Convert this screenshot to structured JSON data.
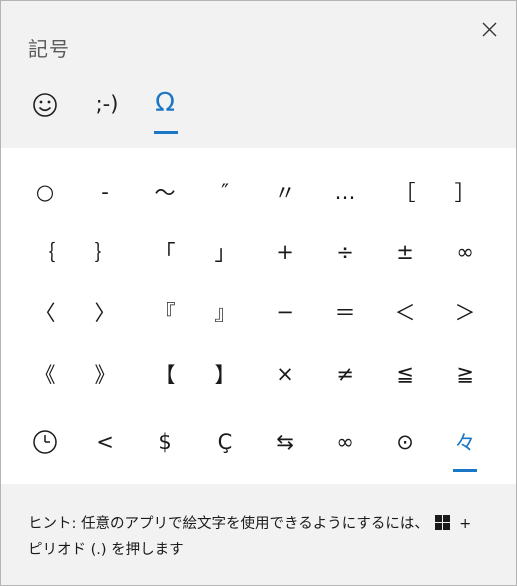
{
  "title": "記号",
  "tabs": {
    "kaomoji_label": ";-)",
    "symbol_label": "Ω"
  },
  "symbols": [
    [
      "○",
      "-",
      "〜",
      "″",
      "〃",
      "…",
      "［",
      "］"
    ],
    [
      "｛",
      "｝",
      "「",
      "」",
      "+",
      "÷",
      "±",
      "∞"
    ],
    [
      "〈",
      "〉",
      "『",
      "』",
      "−",
      "＝",
      "＜",
      "＞"
    ],
    [
      "《",
      "》",
      "【",
      "】",
      "×",
      "≠",
      "≦",
      "≧"
    ],
    [
      "clock-icon",
      "<",
      "$",
      "Ç",
      "⇆",
      "∞",
      "⊙",
      "々"
    ]
  ],
  "selected_symbol": "々",
  "footer": {
    "hint_line1": "ヒント: 任意のアプリで絵文字を使用できるようにするには、",
    "hint_plus": "+",
    "hint_line2": "ピリオド (.) を押します"
  },
  "colors": {
    "accent": "#1a77c6",
    "header_bg": "#f2f2f2",
    "grid_bg": "#ffffff"
  }
}
